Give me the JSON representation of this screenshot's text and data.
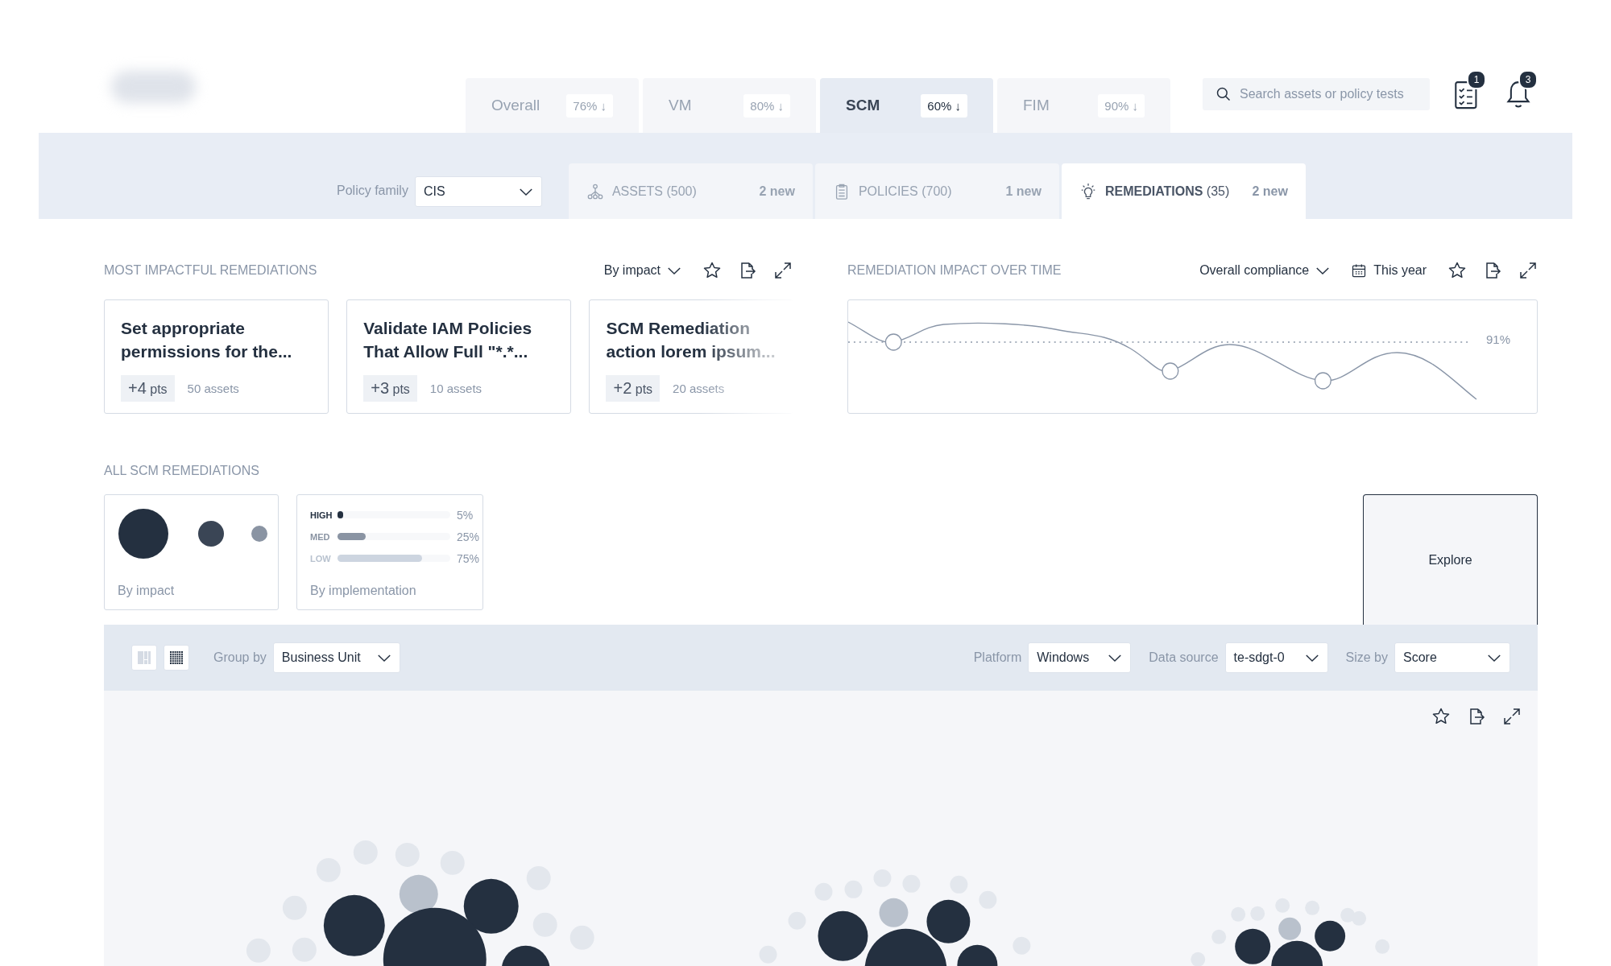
{
  "header": {
    "tabs": [
      {
        "label": "Overall",
        "score": "76% ↓",
        "selected": false
      },
      {
        "label": "VM",
        "score": "80% ↓",
        "selected": false
      },
      {
        "label": "SCM",
        "score": "60% ↓",
        "selected": true
      },
      {
        "label": "FIM",
        "score": "90% ↓",
        "selected": false
      }
    ],
    "search": {
      "placeholder": "Search assets or policy tests"
    },
    "tasks_badge": "1",
    "notifications_badge": "3"
  },
  "filter_bar": {
    "policy_family_label": "Policy family",
    "policy_family": "CIS",
    "subtabs": [
      {
        "label": "ASSETS (500)",
        "new": "2 new",
        "selected": false
      },
      {
        "label": "POLICIES (700)",
        "new": "1 new",
        "selected": false
      },
      {
        "label": "**REMEDIATIONS** (35)",
        "new": "2 new",
        "selected": true
      }
    ]
  },
  "most_impactful": {
    "title": "MOST IMPACTFUL REMEDIATIONS",
    "sort": "By impact",
    "cards": [
      {
        "title": "Set appropriate permissions for the...",
        "points": "+4",
        "unit": "pts",
        "assets": "50 assets"
      },
      {
        "title": "Validate IAM Policies That Allow Full \"*.*...",
        "points": "+3",
        "unit": "pts",
        "assets": "10 assets"
      },
      {
        "title": "SCM Remediation action lorem ipsum...",
        "points": "+2",
        "unit": "pts",
        "assets": "20 assets"
      }
    ]
  },
  "impact_over_time": {
    "title": "REMEDIATION IMPACT OVER TIME",
    "metric": "Overall compliance",
    "period": "This year",
    "target_label": "91%"
  },
  "all_remediations": {
    "title": "ALL SCM REMEDIATIONS",
    "impact_card": {
      "label": "By impact"
    },
    "implementation_card": {
      "label": "By implementation",
      "rows": [
        {
          "name": "HIGH",
          "level": 0.05,
          "value": "5%",
          "color": "#243040"
        },
        {
          "name": "MED",
          "level": 0.25,
          "value": "25%",
          "color": "#8a94a3"
        },
        {
          "name": "LOW",
          "level": 0.75,
          "value": "75%",
          "color": "#cdd5e0"
        }
      ]
    },
    "explore": "Explore"
  },
  "toolbar": {
    "group_by_label": "Group by",
    "group_by": "Business Unit",
    "platform_label": "Platform",
    "platform": "Windows",
    "data_source_label": "Data source",
    "data_source": "te-sdgt-0",
    "size_by_label": "Size by",
    "size_by": "Score"
  }
}
